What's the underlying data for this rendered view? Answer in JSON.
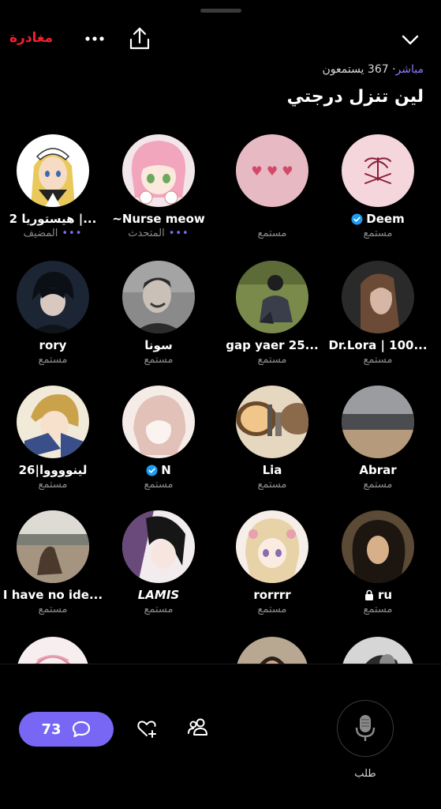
{
  "header": {
    "leave_label": "مغادرة",
    "live_label": "مباشر",
    "listeners_text": "367 يستمعون",
    "title": "لين تنزل درجتي"
  },
  "roles": {
    "host": "المضيف",
    "speaker": "المتحدث",
    "listener": "مستمع"
  },
  "participants": [
    {
      "name": "هيستوريا 2 |...",
      "role": "المضيف",
      "dots": "•••",
      "avatar": "anime-maid-avatar"
    },
    {
      "name": "~Nurse meow",
      "role": "المتحدث",
      "dots": "•••",
      "avatar": "anime-pink-hair-avatar"
    },
    {
      "name": "",
      "role": "مستمع",
      "avatar": "pink-hearts-avatar"
    },
    {
      "name": "Deem",
      "role": "مستمع",
      "verified": true,
      "avatar": "palm-swords-emblem-avatar"
    },
    {
      "name": "rory",
      "role": "مستمع",
      "avatar": "dark-anime-avatar"
    },
    {
      "name": "سونا",
      "role": "مستمع",
      "avatar": "man-laughing-avatar"
    },
    {
      "name": "gap yaer 25...",
      "role": "مستمع",
      "avatar": "man-sitting-grass-avatar"
    },
    {
      "name": "Dr.Lora | 100...",
      "role": "مستمع",
      "avatar": "woman-portrait-avatar"
    },
    {
      "name": "لينووووا|26",
      "role": "مستمع",
      "avatar": "anime-girl-avatar"
    },
    {
      "name": "N",
      "role": "مستمع",
      "verified": true,
      "avatar": "sketch-girl-avatar"
    },
    {
      "name": "Lia",
      "role": "مستمع",
      "avatar": "city-sunglasses-avatar"
    },
    {
      "name": "Abrar",
      "role": "مستمع",
      "avatar": "beach-grey-avatar"
    },
    {
      "name": "I have no ide...",
      "role": "مستمع",
      "avatar": "woman-beach-avatar"
    },
    {
      "name": "LAMIS",
      "role": "مستمع",
      "italic": true,
      "avatar": "anime-dark-hair-avatar"
    },
    {
      "name": "rorrrr",
      "role": "مستمع",
      "avatar": "anime-blonde-avatar"
    },
    {
      "name": "ru",
      "role": "مستمع",
      "locked": true,
      "avatar": "art-woman-curly-avatar"
    },
    {
      "name": "",
      "role": "",
      "avatar": "pink-sketch-avatar"
    },
    {
      "name": "",
      "role": "",
      "avatar": ""
    },
    {
      "name": "",
      "role": "",
      "avatar": "man-photo-avatar"
    },
    {
      "name": "",
      "role": "",
      "avatar": "bw-photo-avatar"
    }
  ],
  "footer": {
    "chat_count": "73",
    "request_label": "طلب"
  },
  "colors": {
    "accent": "#7866f5",
    "leave": "#f4212e",
    "verified": "#1d9bf0",
    "muted": "#8b8b8b"
  }
}
